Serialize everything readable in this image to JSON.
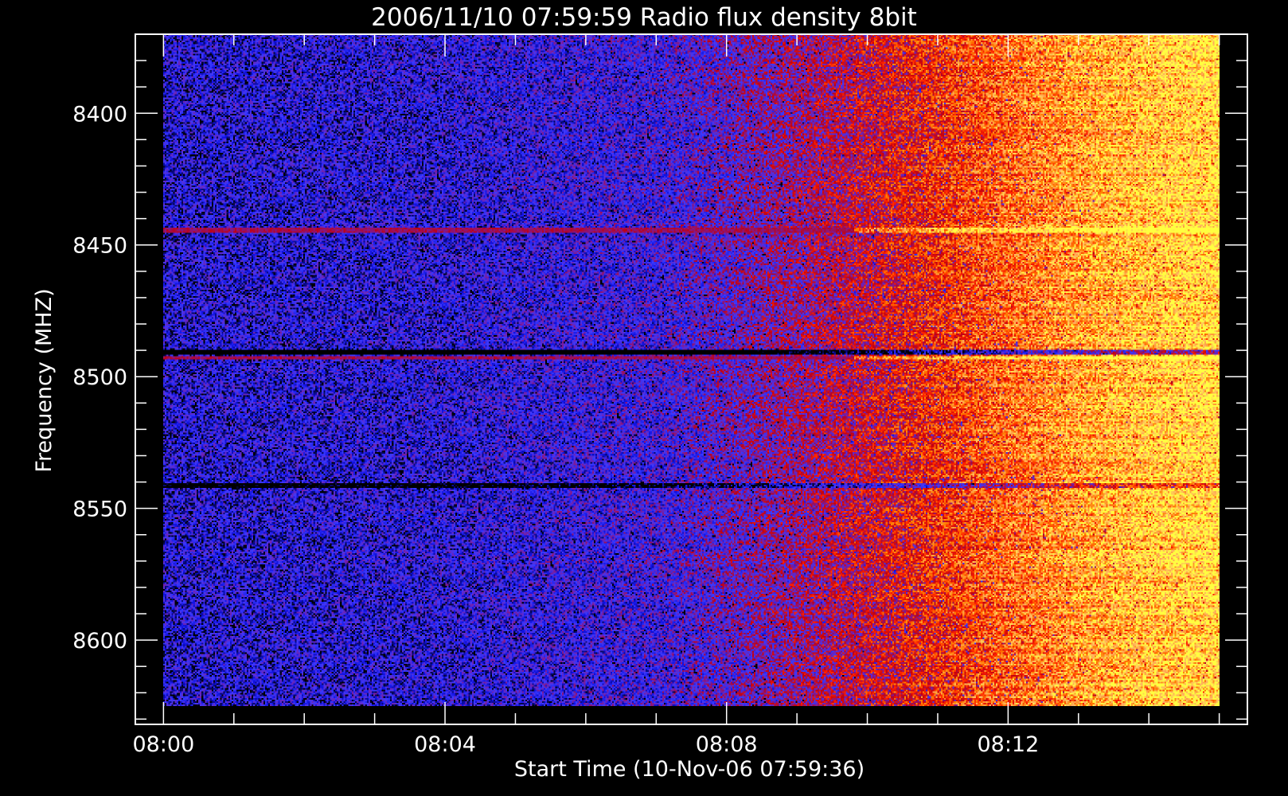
{
  "chart_data": {
    "type": "heatmap",
    "title": "2006/11/10 07:59:59 Radio flux density 8bit",
    "xlabel": "Start Time (10-Nov-06 07:59:36)",
    "ylabel": "Frequency (MHZ)",
    "x_range_minutes": [
      0,
      15
    ],
    "x_start": "08:00",
    "xlim_minutes": [
      -0.4,
      15.4
    ],
    "x_ticks": [
      {
        "label": "08:00",
        "minute": 0
      },
      {
        "label": "08:04",
        "minute": 4
      },
      {
        "label": "08:08",
        "minute": 8
      },
      {
        "label": "08:12",
        "minute": 12
      }
    ],
    "x_minor_tick_minutes": [
      0,
      1,
      2,
      3,
      4,
      5,
      6,
      7,
      8,
      9,
      10,
      11,
      12,
      13,
      14,
      15
    ],
    "ylim": [
      8370,
      8632
    ],
    "data_freq_range": [
      8367,
      8625
    ],
    "y_ticks": [
      8400,
      8450,
      8500,
      8550,
      8600
    ],
    "y_minor_step": 10,
    "y_reversed": true,
    "colormap": [
      "#000000",
      "#1010e0",
      "#3a3aff",
      "#7020b0",
      "#c00010",
      "#ff2000",
      "#ff8000",
      "#ffb060",
      "#ffff40"
    ],
    "flux_trend": [
      {
        "minute": 0,
        "level": 0.18
      },
      {
        "minute": 4,
        "level": 0.2
      },
      {
        "minute": 7,
        "level": 0.26
      },
      {
        "minute": 8,
        "level": 0.33
      },
      {
        "minute": 9,
        "level": 0.42
      },
      {
        "minute": 10,
        "level": 0.52
      },
      {
        "minute": 11,
        "level": 0.63
      },
      {
        "minute": 12,
        "level": 0.74
      },
      {
        "minute": 13,
        "level": 0.84
      },
      {
        "minute": 14,
        "level": 0.92
      },
      {
        "minute": 15,
        "level": 0.97
      }
    ],
    "bands": [
      {
        "freq": 8442,
        "kind": "red-line",
        "strength": 0.35
      },
      {
        "freq": 8489,
        "kind": "dark-line",
        "strength": 0.5
      },
      {
        "freq": 8491,
        "kind": "red-line",
        "strength": 0.4
      },
      {
        "freq": 8540,
        "kind": "dark-line",
        "strength": 0.3
      }
    ]
  }
}
